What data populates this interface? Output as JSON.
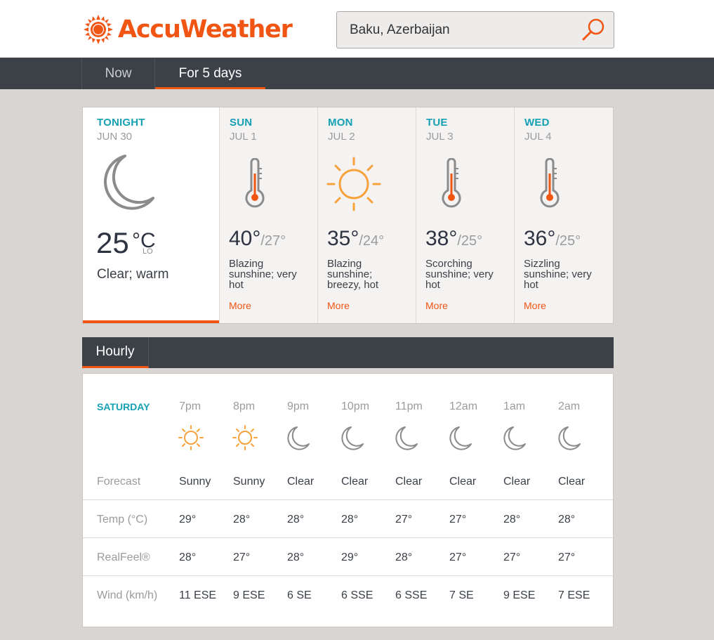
{
  "brand": {
    "name": "AccuWeather",
    "color": "#f05514"
  },
  "search": {
    "value": "Baku, Azerbaijan",
    "icon": "search-icon"
  },
  "nav": {
    "tabs": [
      {
        "label": "Now",
        "active": false
      },
      {
        "label": "For 5 days",
        "active": true
      }
    ]
  },
  "daily": [
    {
      "day": "TONIGHT",
      "date": "JUN 30",
      "icon": "moon-icon",
      "temp": "25",
      "unit": "°C",
      "lo_label": "LO",
      "phrase": "Clear; warm"
    },
    {
      "day": "SUN",
      "date": "JUL 1",
      "icon": "thermometer-icon",
      "hi": "40°",
      "lo": "/27°",
      "phrase": "Blazing sunshine; very hot",
      "more": "More"
    },
    {
      "day": "MON",
      "date": "JUL 2",
      "icon": "sun-icon",
      "hi": "35°",
      "lo": "/24°",
      "phrase": "Blazing sunshine; breezy, hot",
      "more": "More"
    },
    {
      "day": "TUE",
      "date": "JUL 3",
      "icon": "thermometer-icon",
      "hi": "38°",
      "lo": "/25°",
      "phrase": "Scorching sunshine; very hot",
      "more": "More"
    },
    {
      "day": "WED",
      "date": "JUL 4",
      "icon": "thermometer-icon",
      "hi": "36°",
      "lo": "/25°",
      "phrase": "Sizzling sunshine; very hot",
      "more": "More"
    }
  ],
  "hourly": {
    "tab": "Hourly",
    "day": "SATURDAY",
    "hours": [
      {
        "time": "7pm",
        "icon": "sun-icon",
        "forecast": "Sunny",
        "temp": "29°",
        "realfeel": "28°",
        "wind": "11 ESE"
      },
      {
        "time": "8pm",
        "icon": "sun-icon",
        "forecast": "Sunny",
        "temp": "28°",
        "realfeel": "27°",
        "wind": "9 ESE"
      },
      {
        "time": "9pm",
        "icon": "moon-icon",
        "forecast": "Clear",
        "temp": "28°",
        "realfeel": "28°",
        "wind": "6 SE"
      },
      {
        "time": "10pm",
        "icon": "moon-icon",
        "forecast": "Clear",
        "temp": "28°",
        "realfeel": "29°",
        "wind": "6 SSE"
      },
      {
        "time": "11pm",
        "icon": "moon-icon",
        "forecast": "Clear",
        "temp": "27°",
        "realfeel": "28°",
        "wind": "6 SSE"
      },
      {
        "time": "12am",
        "icon": "moon-icon",
        "forecast": "Clear",
        "temp": "27°",
        "realfeel": "27°",
        "wind": "7 SE"
      },
      {
        "time": "1am",
        "icon": "moon-icon",
        "forecast": "Clear",
        "temp": "28°",
        "realfeel": "27°",
        "wind": "9 ESE"
      },
      {
        "time": "2am",
        "icon": "moon-icon",
        "forecast": "Clear",
        "temp": "28°",
        "realfeel": "27°",
        "wind": "7 ESE"
      }
    ],
    "row_labels": {
      "forecast": "Forecast",
      "temp": "Temp (°C)",
      "realfeel": "RealFeel®",
      "wind": "Wind (km/h)"
    }
  },
  "colors": {
    "accent": "#f05514",
    "teal": "#16a0b5",
    "nav_bg": "#3c4148",
    "sun": "#f7a23b"
  }
}
